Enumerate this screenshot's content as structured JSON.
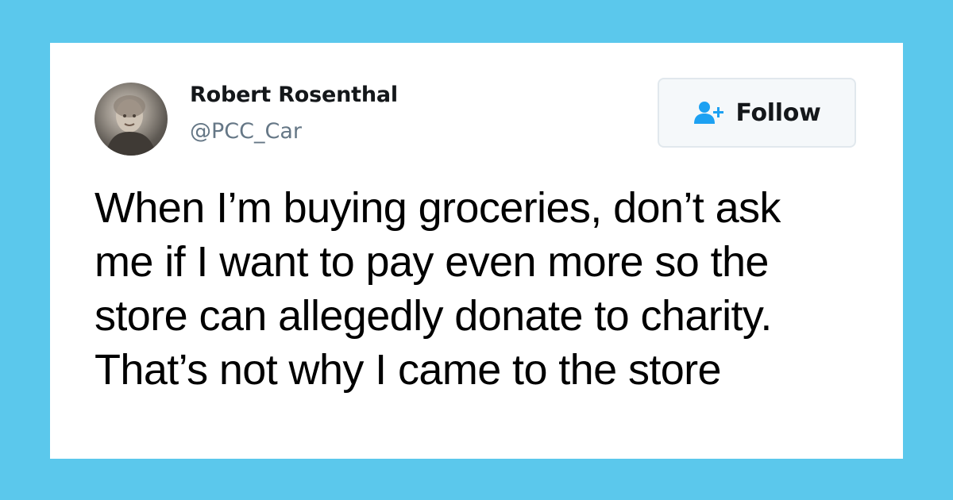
{
  "tweet": {
    "author": {
      "name": "Robert Rosenthal",
      "handle": "@PCC_Car",
      "avatar_icon": "profile-photo"
    },
    "follow_button": {
      "label": "Follow",
      "icon": "add-user-icon",
      "icon_color": "#1da1f2"
    },
    "text_lines": [
      "When I’m buying groceries, don’t ask",
      "me if I want to pay even more so the",
      "store can allegedly donate to charity.",
      "That’s not why I came to the store"
    ]
  },
  "colors": {
    "background": "#5bc8ec",
    "card": "#ffffff",
    "accent": "#1da1f2"
  }
}
